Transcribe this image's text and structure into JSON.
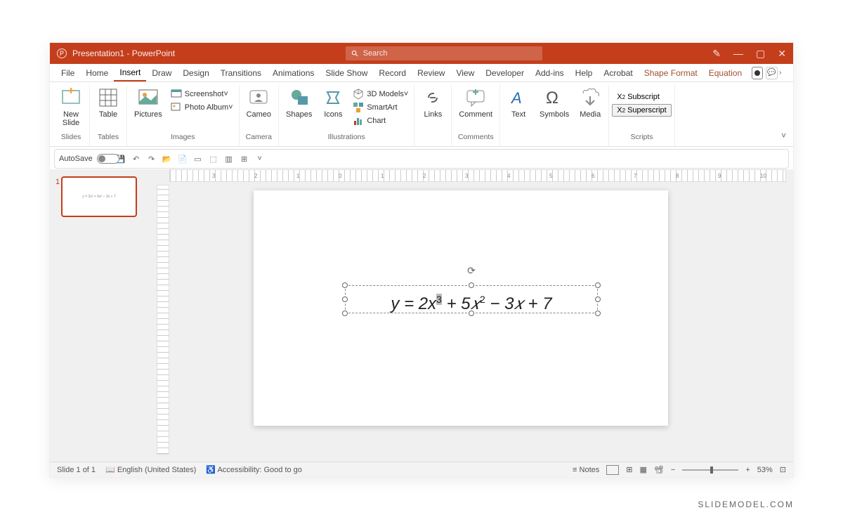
{
  "title": "Presentation1 - PowerPoint",
  "search_placeholder": "Search",
  "menu": {
    "file": "File",
    "home": "Home",
    "insert": "Insert",
    "draw": "Draw",
    "design": "Design",
    "transitions": "Transitions",
    "animations": "Animations",
    "slideshow": "Slide Show",
    "record": "Record",
    "review": "Review",
    "view": "View",
    "developer": "Developer",
    "addins": "Add-ins",
    "help": "Help",
    "acrobat": "Acrobat",
    "shapeformat": "Shape Format",
    "equation": "Equation"
  },
  "ribbon": {
    "newslide": "New\nSlide",
    "table": "Table",
    "pictures": "Pictures",
    "screenshot": "Screenshot",
    "photoalbum": "Photo Album",
    "cameo": "Cameo",
    "shapes": "Shapes",
    "icons": "Icons",
    "models": "3D Models",
    "smartart": "SmartArt",
    "chart": "Chart",
    "links": "Links",
    "comment": "Comment",
    "text": "Text",
    "symbols": "Symbols",
    "media": "Media",
    "subscript": "Subscript",
    "superscript": "Superscript",
    "g_slides": "Slides",
    "g_tables": "Tables",
    "g_images": "Images",
    "g_camera": "Camera",
    "g_illustrations": "Illustrations",
    "g_comments": "Comments",
    "g_scripts": "Scripts"
  },
  "qat": {
    "autosave": "AutoSave",
    "off": "Off"
  },
  "thumb_preview": "y = 2x³ + 5x² − 3x + 7",
  "equation": {
    "p1": "y = 2x",
    "sup1": "3",
    "p2": " + 5𝑥",
    "sup2": "2",
    "p3": " − 3𝑥 + 7"
  },
  "status": {
    "slide": "Slide 1 of 1",
    "lang": "English (United States)",
    "acc": "Accessibility: Good to go",
    "notes": "Notes",
    "zoom": "53%"
  },
  "watermark": "SLIDEMODEL.COM"
}
